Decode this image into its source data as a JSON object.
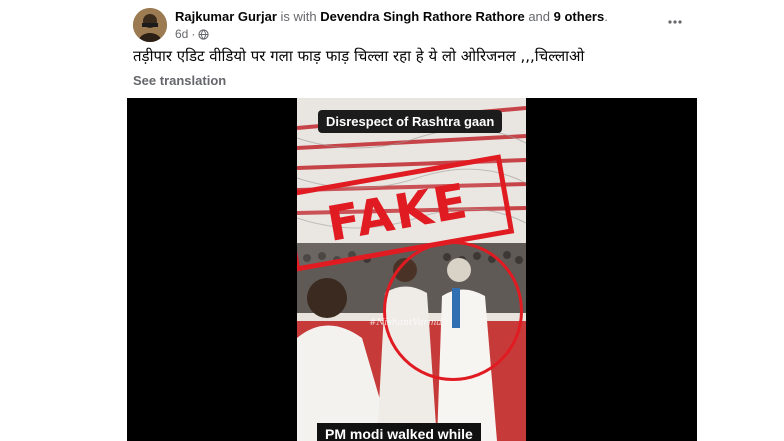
{
  "post": {
    "author": "Rajkumar Gurjar",
    "is_with_text": "is with",
    "tagged_person": "Devendra Singh Rathore Rathore",
    "and_text": "and",
    "others": "9 others",
    "period": ".",
    "timestamp": "6d",
    "audience_icon": "globe-icon",
    "caption": "तड़ीपार एडिट वीडियो पर गला फाड़ फाड़ चिल्ला रहा हे ये लो ओरिजनल ,,,चिल्लाओ",
    "see_translation": "See translation",
    "more_icon": "three-dots-icon"
  },
  "video": {
    "headline": "Disrespect of Rashtra gaan",
    "stamp": "FAKE",
    "watermark": "#NishantVarma",
    "subtitle": "PM modi walked while"
  },
  "colors": {
    "stamp_red": "#e11b22",
    "muted_text": "#65676b",
    "video_bg": "#000000"
  }
}
